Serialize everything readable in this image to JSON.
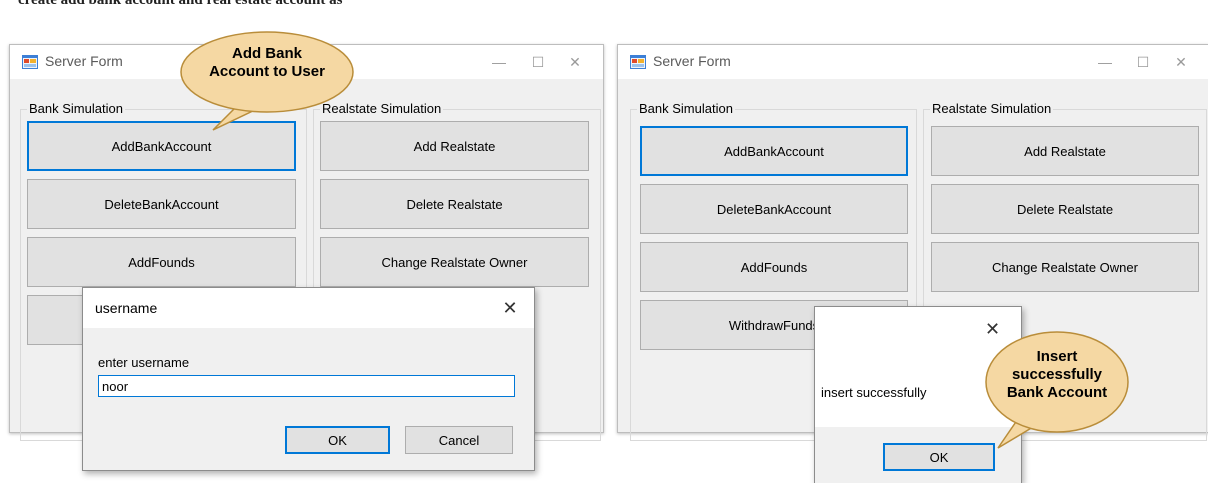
{
  "caption": "create add bank account and real estate account as",
  "window": {
    "title": "Server Form",
    "minimize_glyph": "—",
    "maximize_glyph": "☐",
    "close_glyph": "✕"
  },
  "bank": {
    "group_label": "Bank Simulation",
    "add": "AddBankAccount",
    "delete": "DeleteBankAccount",
    "add_founds": "AddFounds",
    "withdraw": "WithdrawFunds"
  },
  "realstate": {
    "group_label": "Realstate Simulation",
    "add": "Add Realstate",
    "delete": "Delete Realstate",
    "change_owner": "Change Realstate Owner"
  },
  "input_dialog": {
    "title": "username",
    "prompt": "enter username",
    "value": "noor",
    "ok": "OK",
    "cancel": "Cancel",
    "close_glyph": "✕"
  },
  "message_box": {
    "message": "insert successfully",
    "ok": "OK",
    "close_glyph": "✕"
  },
  "callouts": {
    "left_line1": "Add Bank",
    "left_line2": "Account to User",
    "right_line1": "Insert",
    "right_line2": "successfully",
    "right_line3": "Bank Account"
  },
  "colors": {
    "focus_border": "#0078d7",
    "callout_fill": "#f5d8a3",
    "callout_stroke": "#b98d3a"
  },
  "icons": {
    "app": "server-form-app-icon"
  }
}
